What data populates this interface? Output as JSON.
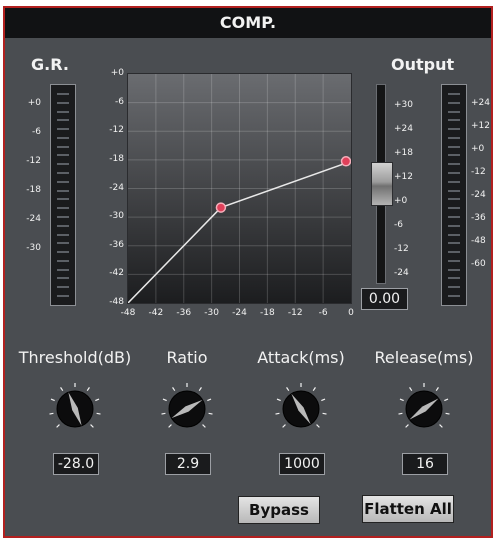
{
  "window": {
    "title": "COMP."
  },
  "gr_meter": {
    "label": "G.R.",
    "scale": [
      "+0",
      "-6",
      "-12",
      "-18",
      "-24",
      "-30"
    ]
  },
  "output": {
    "label": "Output",
    "fader_scale": [
      "+30",
      "+24",
      "+18",
      "+12",
      "+0",
      "-6",
      "-12",
      "-24"
    ],
    "meter_scale": [
      "+24",
      "+12",
      "+0",
      "-12",
      "-24",
      "-36",
      "-48",
      "-60"
    ],
    "value": "0.00",
    "fader_level": 0.5
  },
  "transfer_curve": {
    "y_ticks": [
      "+0",
      "-6",
      "-12",
      "-18",
      "-24",
      "-30",
      "-36",
      "-42",
      "-48"
    ],
    "x_ticks": [
      "-48",
      "-42",
      "-36",
      "-30",
      "-24",
      "-18",
      "-12",
      "-6",
      "0"
    ],
    "range": [
      -48,
      0
    ],
    "points": [
      [
        -48,
        -48
      ],
      [
        -28,
        -28
      ],
      [
        0,
        -18.3
      ]
    ],
    "line_color": "#e8e8e8",
    "point_color": "#e0405a"
  },
  "knobs": [
    {
      "id": "threshold",
      "label": "Threshold(dB)",
      "value": "-28.0",
      "level": 0.42
    },
    {
      "id": "ratio",
      "label": "Ratio",
      "value": "2.9",
      "level": 0.72
    },
    {
      "id": "attack",
      "label": "Attack(ms)",
      "value": "1000",
      "level": 0.38
    },
    {
      "id": "release",
      "label": "Release(ms)",
      "value": "16",
      "level": 0.7
    }
  ],
  "buttons": {
    "bypass": "Bypass",
    "flatten_all": "Flatten All"
  },
  "colors": {
    "panel": "#4a4d51",
    "border": "#b2201f",
    "titlebar": "#111214",
    "text": "#f2f2f2"
  }
}
